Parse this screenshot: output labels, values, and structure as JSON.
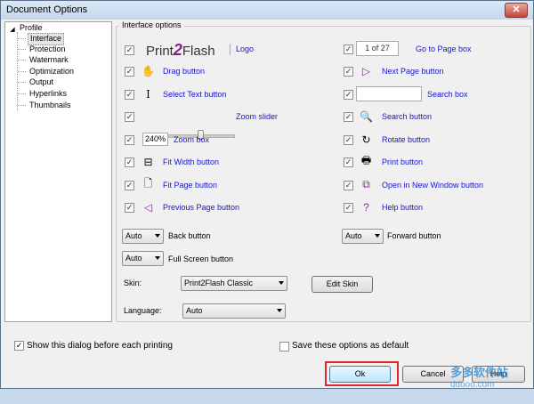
{
  "window": {
    "title": "Document Options",
    "close_glyph": "✕"
  },
  "tree": {
    "root": "Profile",
    "items": [
      "Interface",
      "Protection",
      "Watermark",
      "Optimization",
      "Output",
      "Hyperlinks",
      "Thumbnails"
    ],
    "selected": "Interface"
  },
  "group": {
    "title": "Interface options"
  },
  "logo": {
    "text_a": "Print",
    "text_two": "2",
    "text_b": "Flash",
    "link": "Logo"
  },
  "left_options": [
    {
      "label": "Drag button",
      "icon": "hand-icon"
    },
    {
      "label": "Select Text button",
      "icon": "text-cursor-icon"
    },
    {
      "label": "Zoom slider",
      "icon": "slider-icon"
    },
    {
      "label": "Zoom box",
      "icon": "zoom-box-icon",
      "value": "240%"
    },
    {
      "label": "Fit Width button",
      "icon": "fit-width-icon"
    },
    {
      "label": "Fit Page button",
      "icon": "fit-page-icon"
    },
    {
      "label": "Previous Page button",
      "icon": "prev-page-icon"
    }
  ],
  "right_options": [
    {
      "label": "Go to Page box",
      "icon": "page-box-icon",
      "value": "1 of 27"
    },
    {
      "label": "Next Page button",
      "icon": "next-page-icon"
    },
    {
      "label": "Search box",
      "icon": "search-box-icon"
    },
    {
      "label": "Search button",
      "icon": "magnifier-icon"
    },
    {
      "label": "Rotate button",
      "icon": "rotate-icon"
    },
    {
      "label": "Print button",
      "icon": "printer-icon"
    },
    {
      "label": "Open in New Window button",
      "icon": "new-window-icon"
    },
    {
      "label": "Help button",
      "icon": "help-icon"
    }
  ],
  "selects": {
    "back": {
      "value": "Auto",
      "label": "Back button"
    },
    "forward": {
      "value": "Auto",
      "label": "Forward button"
    },
    "fullscreen": {
      "value": "Auto",
      "label": "Full Screen button"
    },
    "skin": {
      "label": "Skin:",
      "value": "Print2Flash Classic"
    },
    "language": {
      "label": "Language:",
      "value": "Auto"
    }
  },
  "buttons": {
    "edit_skin": "Edit Skin",
    "ok": "Ok",
    "cancel": "Cancel",
    "help": "Help"
  },
  "bottom": {
    "show_dialog": "Show this dialog before each printing",
    "save_default": "Save these options as default"
  },
  "watermark": {
    "text": "多多软件站",
    "sub": "ddooo.com"
  },
  "colors": {
    "link_blue": "#1515cc",
    "highlight_red": "#e0262a",
    "title_gradient_top": "#dbe8f6"
  }
}
